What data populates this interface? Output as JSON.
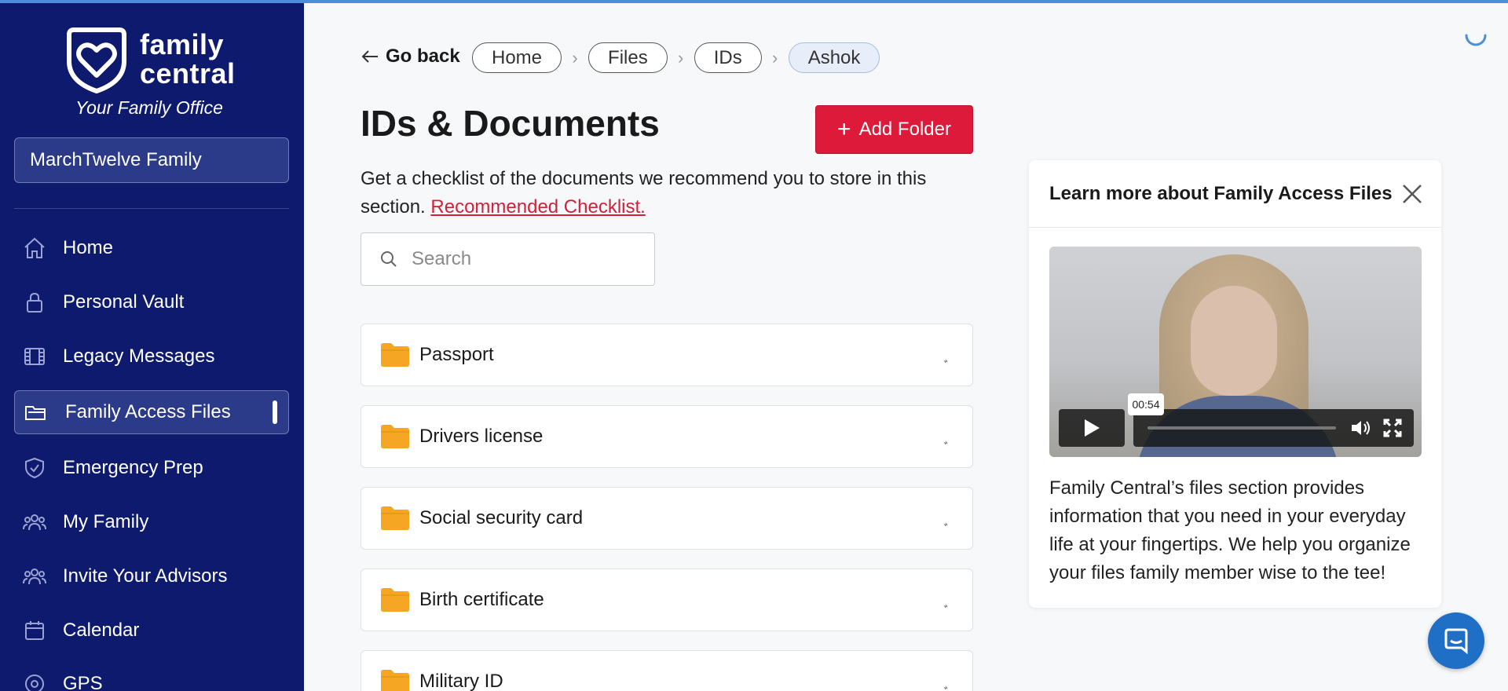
{
  "brand": {
    "name_line1": "family",
    "name_line2": "central",
    "tagline": "Your Family Office"
  },
  "family_selector": {
    "value": "MarchTwelve Family"
  },
  "sidebar": {
    "items": [
      {
        "label": "Home",
        "icon": "home-icon"
      },
      {
        "label": "Personal Vault",
        "icon": "lock-icon"
      },
      {
        "label": "Legacy Messages",
        "icon": "film-icon"
      },
      {
        "label": "Family Access Files",
        "icon": "folder-icon",
        "active": true
      },
      {
        "label": "Emergency Prep",
        "icon": "shield-icon"
      },
      {
        "label": "My Family",
        "icon": "people-icon"
      },
      {
        "label": "Invite Your Advisors",
        "icon": "people-icon"
      },
      {
        "label": "Calendar",
        "icon": "calendar-icon"
      },
      {
        "label": "GPS",
        "icon": "location-icon"
      }
    ]
  },
  "header": {
    "go_back": "Go back",
    "breadcrumbs": [
      "Home",
      "Files",
      "IDs",
      "Ashok"
    ]
  },
  "main": {
    "title": "IDs & Documents",
    "add_folder_label": "Add Folder",
    "description": "Get a checklist of the documents we recommend you to store in this section. ",
    "checklist_link": "Recommended Checklist.",
    "search_placeholder": "Search",
    "folders": [
      "Passport",
      "Drivers license",
      "Social security card",
      "Birth certificate",
      "Military ID"
    ]
  },
  "help_panel": {
    "title": "Learn more about Family Access Files",
    "video_time": "00:54",
    "body": "Family Central’s files section provides information that you need in your everyday life at your fingertips. We help you organize your files family member wise to the tee!"
  },
  "colors": {
    "sidebar_bg": "#0d1a6e",
    "accent_red": "#dd1a3a",
    "folder_yellow": "#f5a623",
    "chat_blue": "#1e6fc5"
  }
}
